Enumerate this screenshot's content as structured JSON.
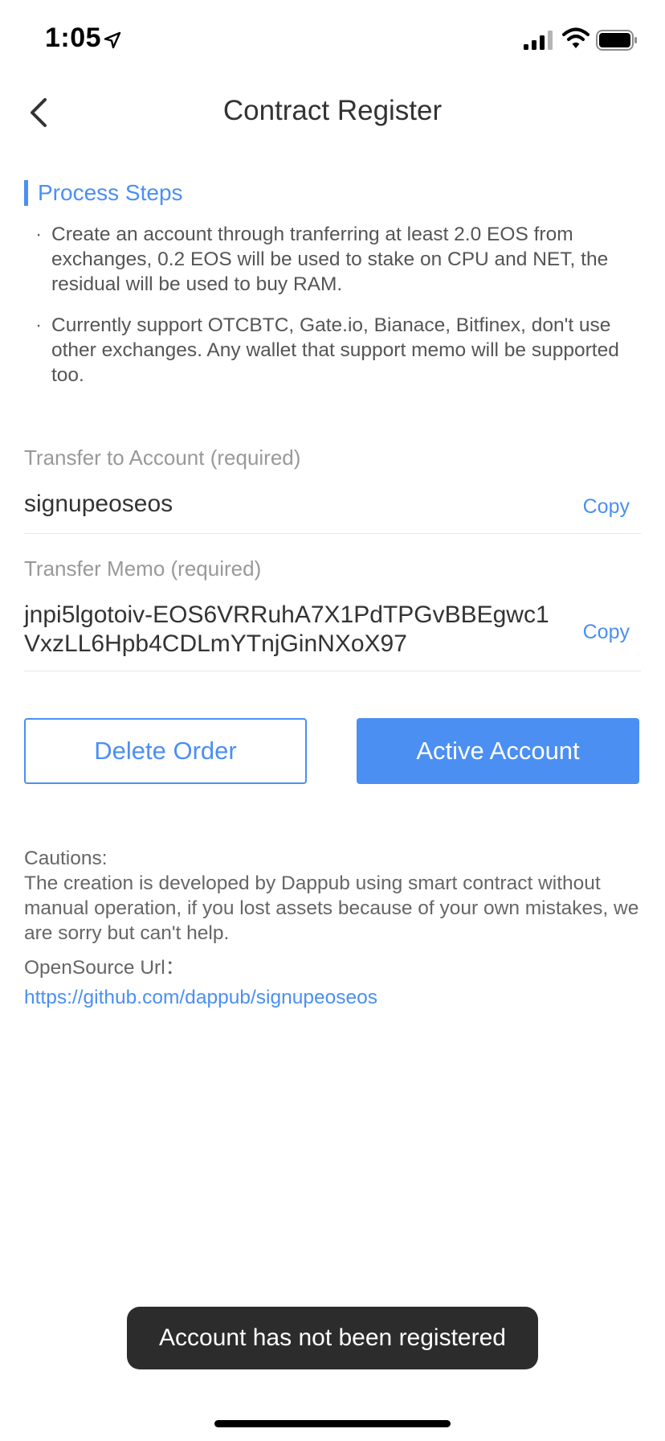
{
  "status_bar": {
    "time": "1:05"
  },
  "nav": {
    "title": "Contract Register"
  },
  "process": {
    "header": "Process Steps",
    "bullet": "·",
    "steps": [
      "Create an account through tranferring at least 2.0 EOS from exchanges, 0.2 EOS will be used to stake on CPU and NET, the residual will be used to buy RAM.",
      "Currently support OTCBTC, Gate.io, Bianace, Bitfinex, don't use other exchanges. Any wallet that support memo will be supported too."
    ]
  },
  "transfer_account": {
    "label": "Transfer to Account (required)",
    "value": "signupeoseos",
    "copy_label": "Copy"
  },
  "transfer_memo": {
    "label": "Transfer Memo (required)",
    "value": "jnpi5lgotoiv-EOS6VRRuhA7X1PdTPGvBBEgwc1VxzLL6Hpb4CDLmYTnjGinNXoX97",
    "copy_label": "Copy"
  },
  "actions": {
    "delete_label": "Delete Order",
    "activate_label": "Active Account"
  },
  "cautions": {
    "title": "Cautions:",
    "text": "The creation is developed by Dappub using smart contract without manual operation, if you lost assets because of your own mistakes, we are sorry but can't help.",
    "opensource_label": "OpenSource Url：",
    "opensource_url": "https://github.com/dappub/signupeoseos"
  },
  "toast": {
    "message": "Account has not been registered"
  },
  "colors": {
    "accent": "#4b8ff2",
    "text_primary": "#333333",
    "text_secondary": "#999999",
    "toast_bg": "#2c2c2c"
  },
  "icons": {
    "back": "chevron-left-icon",
    "location": "location-arrow-icon",
    "signal": "cellular-signal-icon",
    "wifi": "wifi-icon",
    "battery": "battery-icon"
  }
}
